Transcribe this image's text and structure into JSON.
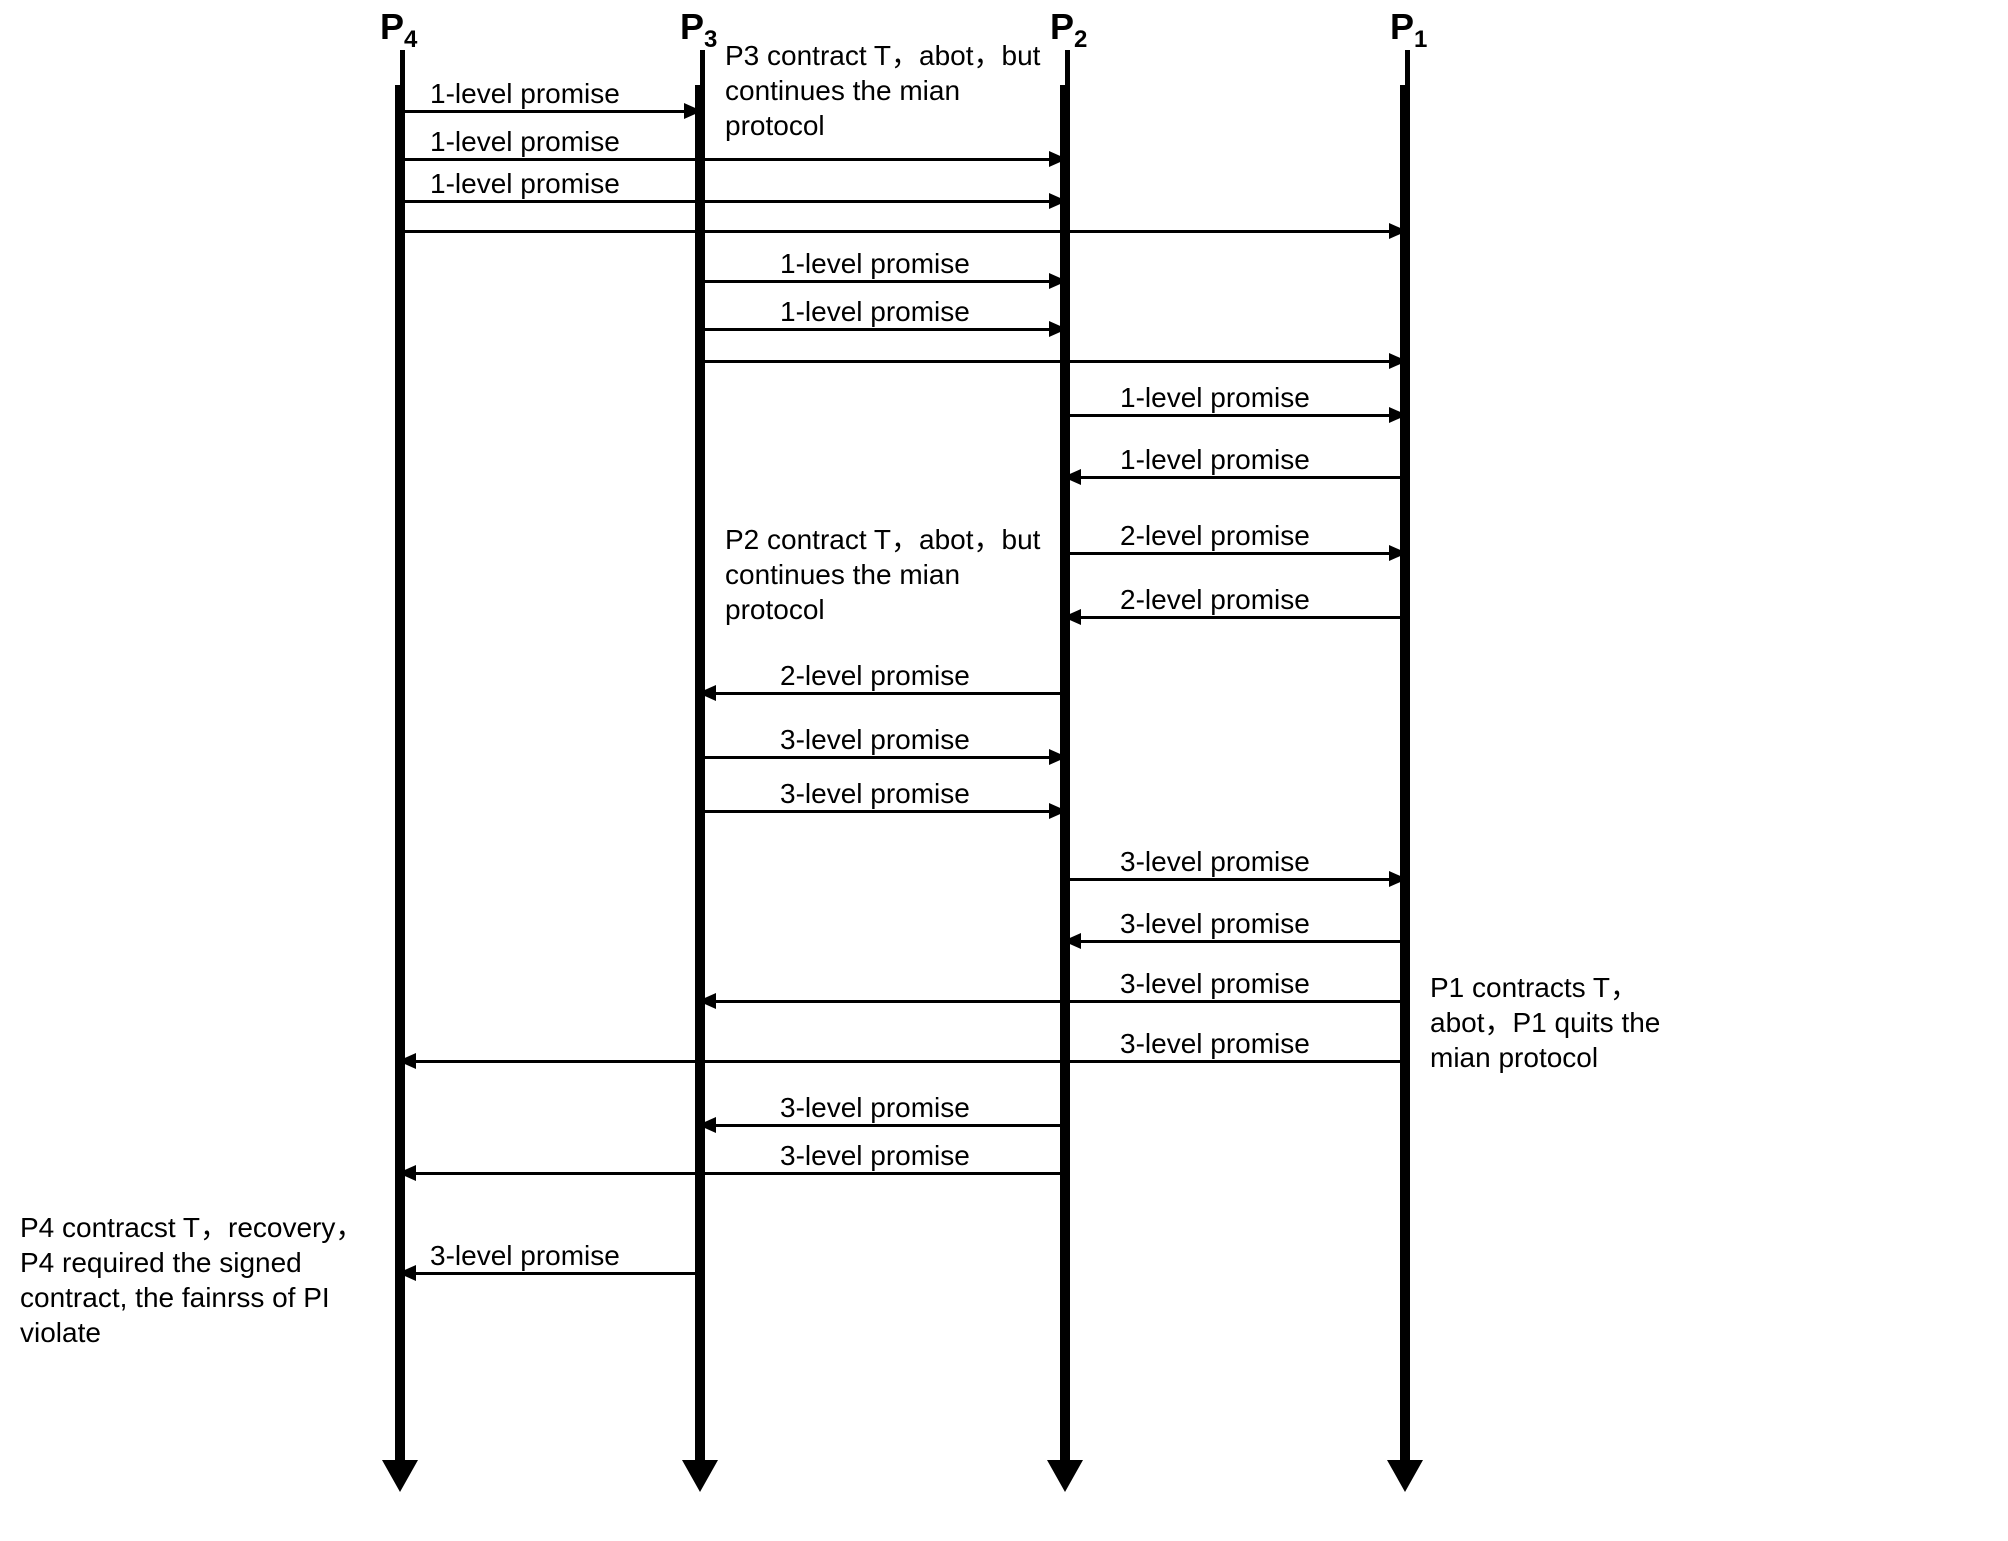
{
  "participants": {
    "p4": "P4",
    "p3": "P3",
    "p2": "P2",
    "p1": "P1"
  },
  "labels": {
    "lvl1": "1-level promise",
    "lvl2": "2-level promise",
    "lvl3": "3-level promise"
  },
  "notes": {
    "p3_top": "P3 contract T，abot，but continues the mian protocol",
    "p2_mid": "P2 contract T，abot，but continues the mian protocol",
    "p1_side": "P1 contracts T，abot，P1 quits the mian protocol",
    "p4_bottom": "P4 contracst T，recovery，P4 required the signed contract, the fainrss of PI violate"
  },
  "chart_data": {
    "type": "sequence-diagram",
    "participants": [
      "P4",
      "P3",
      "P2",
      "P1"
    ],
    "messages": [
      {
        "from": "P4",
        "to": "P3",
        "text": "1-level promise"
      },
      {
        "from": "P4",
        "to": "P2",
        "text": "1-level promise"
      },
      {
        "from": "P4",
        "to": "P2",
        "text": "1-level promise"
      },
      {
        "from": "P4",
        "to": "P1",
        "text": ""
      },
      {
        "from": "P3",
        "to": "P2",
        "text": "1-level promise"
      },
      {
        "from": "P3",
        "to": "P2",
        "text": "1-level promise"
      },
      {
        "from": "P3",
        "to": "P1",
        "text": ""
      },
      {
        "from": "P2",
        "to": "P1",
        "text": "1-level promise"
      },
      {
        "from": "P1",
        "to": "P2",
        "text": "1-level promise"
      },
      {
        "from": "P2",
        "to": "P1",
        "text": "2-level promise"
      },
      {
        "from": "P1",
        "to": "P2",
        "text": "2-level promise"
      },
      {
        "from": "P2",
        "to": "P3",
        "text": "2-level promise"
      },
      {
        "from": "P3",
        "to": "P2",
        "text": "3-level promise"
      },
      {
        "from": "P3",
        "to": "P2",
        "text": "3-level promise"
      },
      {
        "from": "P2",
        "to": "P1",
        "text": "3-level promise"
      },
      {
        "from": "P1",
        "to": "P2",
        "text": "3-level promise"
      },
      {
        "from": "P1",
        "to": "P3",
        "text": "3-level promise"
      },
      {
        "from": "P1",
        "to": "P4",
        "text": "3-level promise"
      },
      {
        "from": "P2",
        "to": "P3",
        "text": "3-level promise"
      },
      {
        "from": "P2",
        "to": "P4",
        "text": "3-level promise"
      },
      {
        "from": "P3",
        "to": "P4",
        "text": "3-level promise"
      }
    ],
    "annotations": [
      {
        "on": "P3",
        "text": "P3 contract T，abot，but continues the mian protocol"
      },
      {
        "on": "P2",
        "text": "P2 contract T，abot，but continues the mian protocol"
      },
      {
        "on": "P1",
        "text": "P1 contracts T，abot，P1 quits the mian protocol"
      },
      {
        "on": "P4",
        "text": "P4 contracst T，recovery，P4 required the signed contract, the fainrss of PI violate"
      }
    ]
  }
}
